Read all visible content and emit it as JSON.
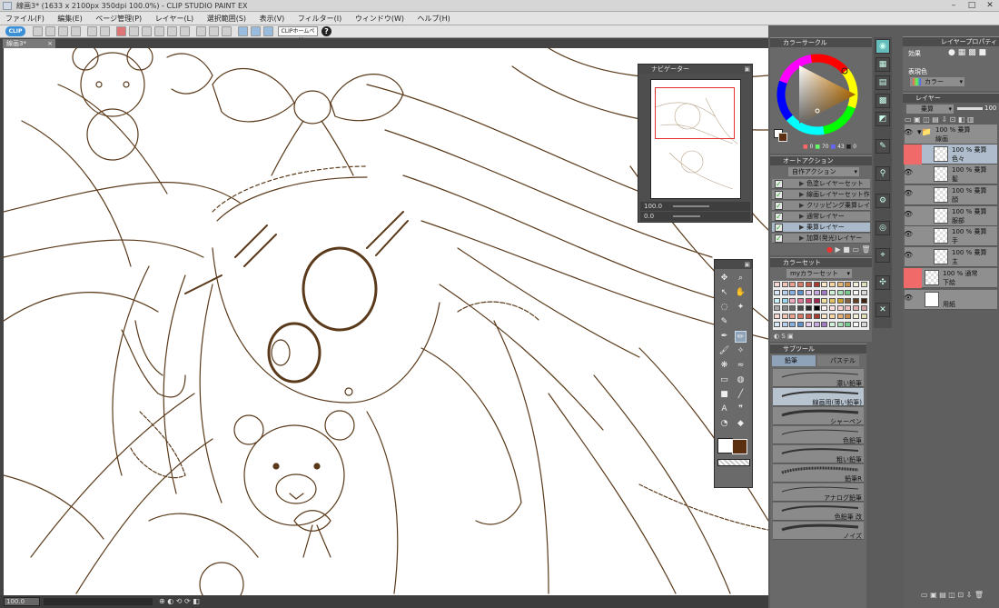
{
  "window": {
    "title": "線画3* (1633 x 2100px 350dpi 100.0%) - CLIP STUDIO PAINT EX"
  },
  "menu": [
    "ファイル(F)",
    "編集(E)",
    "ページ管理(P)",
    "レイヤー(L)",
    "選択範囲(S)",
    "表示(V)",
    "フィルター(I)",
    "ウィンドウ(W)",
    "ヘルプ(H)"
  ],
  "command_bar": {
    "clip_label": "CLIP",
    "home_label": "CLIPホームページ",
    "help_label": "?"
  },
  "tab": {
    "label": "線画3*",
    "close": "×"
  },
  "navigator": {
    "title": "ナビゲーター",
    "zoom": "100.0",
    "angle": "0.0"
  },
  "color_wheel": {
    "title": "カラーサークル",
    "readout": [
      "0",
      "70",
      "43",
      "0"
    ],
    "main_color": "#5a3010",
    "sub_color": "#ffffff"
  },
  "auto_action": {
    "title": "オートアクション",
    "set_name": "自作アクション",
    "items": [
      {
        "label": "色塗レイヤーセット(下)",
        "selected": false
      },
      {
        "label": "線画レイヤーセット作成",
        "selected": false
      },
      {
        "label": "クリッピング乗算レイヤー",
        "selected": false
      },
      {
        "label": "通常レイヤー",
        "selected": false
      },
      {
        "label": "乗算レイヤー",
        "selected": true
      },
      {
        "label": "加算(発光)レイヤー",
        "selected": false
      }
    ]
  },
  "color_set": {
    "title": "カラーセット",
    "set_name": "myカラーセット"
  },
  "sub_tool": {
    "title": "サブツール",
    "tabs": [
      "鉛筆",
      "パステル"
    ],
    "brushes": [
      {
        "label": "濃い鉛筆",
        "selected": false
      },
      {
        "label": "線画用(薄い鉛筆)",
        "selected": true
      },
      {
        "label": "シャーペン",
        "selected": false
      },
      {
        "label": "色鉛筆",
        "selected": false
      },
      {
        "label": "粗い鉛筆",
        "selected": false
      },
      {
        "label": "鉛筆R",
        "selected": false
      },
      {
        "label": "アナログ鉛筆",
        "selected": false
      },
      {
        "label": "色鉛筆 改",
        "selected": false
      },
      {
        "label": "ノイズ",
        "selected": false
      }
    ]
  },
  "layer_property": {
    "title": "レイヤープロパティ",
    "effect_label": "効果",
    "expression_label": "表現色",
    "expression_value": "カラー"
  },
  "layers": {
    "title": "レイヤー",
    "blend_mode": "乗算",
    "opacity": "100",
    "items": [
      {
        "line1": "100 % 乗算",
        "line2": "線画",
        "folder": true,
        "selected": false
      },
      {
        "line1": "100 % 乗算",
        "line2": "色々",
        "folder": false,
        "selected": true
      },
      {
        "line1": "100 % 乗算",
        "line2": "髪",
        "folder": false,
        "selected": false
      },
      {
        "line1": "100 % 乗算",
        "line2": "顔",
        "folder": false,
        "selected": false
      },
      {
        "line1": "100 % 乗算",
        "line2": "服部",
        "folder": false,
        "selected": false
      },
      {
        "line1": "100 % 乗算",
        "line2": "手",
        "folder": false,
        "selected": false
      },
      {
        "line1": "100 % 乗算",
        "line2": "主",
        "folder": false,
        "selected": false
      },
      {
        "line1": "100 % 通常",
        "line2": "下絵",
        "folder": false,
        "selected": false
      },
      {
        "line1": "",
        "line2": "用紙",
        "folder": false,
        "selected": false
      }
    ]
  },
  "status": {
    "zoom": "100.0"
  },
  "colors": {
    "line_art": "#5a3a1a",
    "selection": "#aab9c9",
    "accent_red": "#f06a6a"
  }
}
